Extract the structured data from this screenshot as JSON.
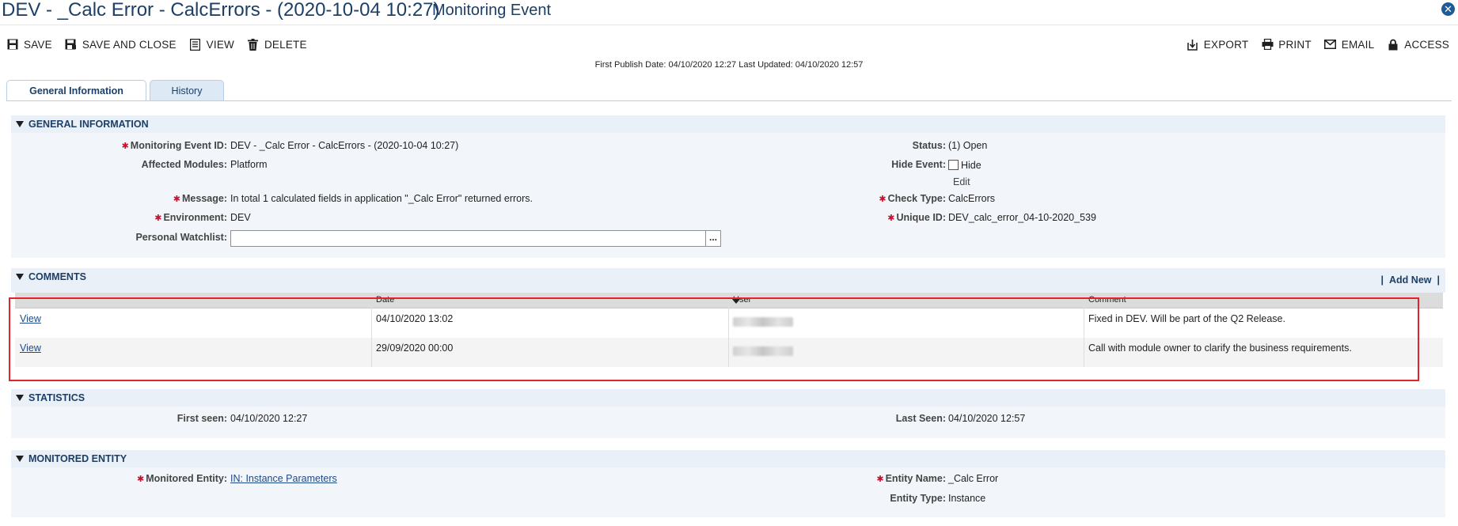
{
  "header": {
    "title": "DEV - _Calc Error - CalcErrors - (2020-10-04 10:27)",
    "subtitle": "Monitoring Event"
  },
  "toolbar": {
    "save": "SAVE",
    "save_close": "SAVE AND CLOSE",
    "view": "VIEW",
    "delete": "DELETE",
    "export": "EXPORT",
    "print": "PRINT",
    "email": "EMAIL",
    "access": "ACCESS"
  },
  "publish": {
    "first_label": "First Publish Date:",
    "first_value": "04/10/2020 12:27",
    "updated_label": "Last Updated:",
    "updated_value": "04/10/2020 12:57"
  },
  "tabs": [
    {
      "label": "General Information",
      "active": true
    },
    {
      "label": "History",
      "active": false
    }
  ],
  "general": {
    "title": "GENERAL INFORMATION",
    "event_id_label": "Monitoring Event ID:",
    "event_id_value": "DEV - _Calc Error - CalcErrors - (2020-10-04 10:27)",
    "modules_label": "Affected Modules:",
    "modules_value": "Platform",
    "message_label": "Message:",
    "message_value": "In total 1 calculated fields in application \"_Calc Error\" returned errors.",
    "environment_label": "Environment:",
    "environment_value": "DEV",
    "watchlist_label": "Personal Watchlist:",
    "watchlist_button": "...",
    "status_label": "Status:",
    "status_value": "(1) Open",
    "hide_label": "Hide Event:",
    "hide_checkbox_label": "Hide",
    "hide_edit": "Edit",
    "check_type_label": "Check Type:",
    "check_type_value": "CalcErrors",
    "unique_id_label": "Unique ID:",
    "unique_id_value": "DEV_calc_error_04-10-2020_539"
  },
  "comments": {
    "title": "COMMENTS",
    "add_new": "Add New",
    "columns": [
      "",
      "Date",
      "User",
      "Comment"
    ],
    "rows": [
      {
        "action": "View",
        "date": "04/10/2020 13:02",
        "comment": "Fixed in DEV. Will be part of the Q2 Release."
      },
      {
        "action": "View",
        "date": "29/09/2020 00:00",
        "comment": "Call with module owner to clarify the business requirements."
      }
    ]
  },
  "statistics": {
    "title": "STATISTICS",
    "first_seen_label": "First seen:",
    "first_seen_value": "04/10/2020 12:27",
    "last_seen_label": "Last Seen:",
    "last_seen_value": "04/10/2020 12:57"
  },
  "monitored": {
    "title": "MONITORED ENTITY",
    "entity_label": "Monitored Entity:",
    "entity_value": "IN: Instance Parameters",
    "entity_name_label": "Entity Name:",
    "entity_name_value": "_Calc Error",
    "entity_type_label": "Entity Type:",
    "entity_type_value": "Instance"
  },
  "colors": {
    "accent": "#1d3f66",
    "required": "#c8102e",
    "highlight": "#e0242e"
  }
}
